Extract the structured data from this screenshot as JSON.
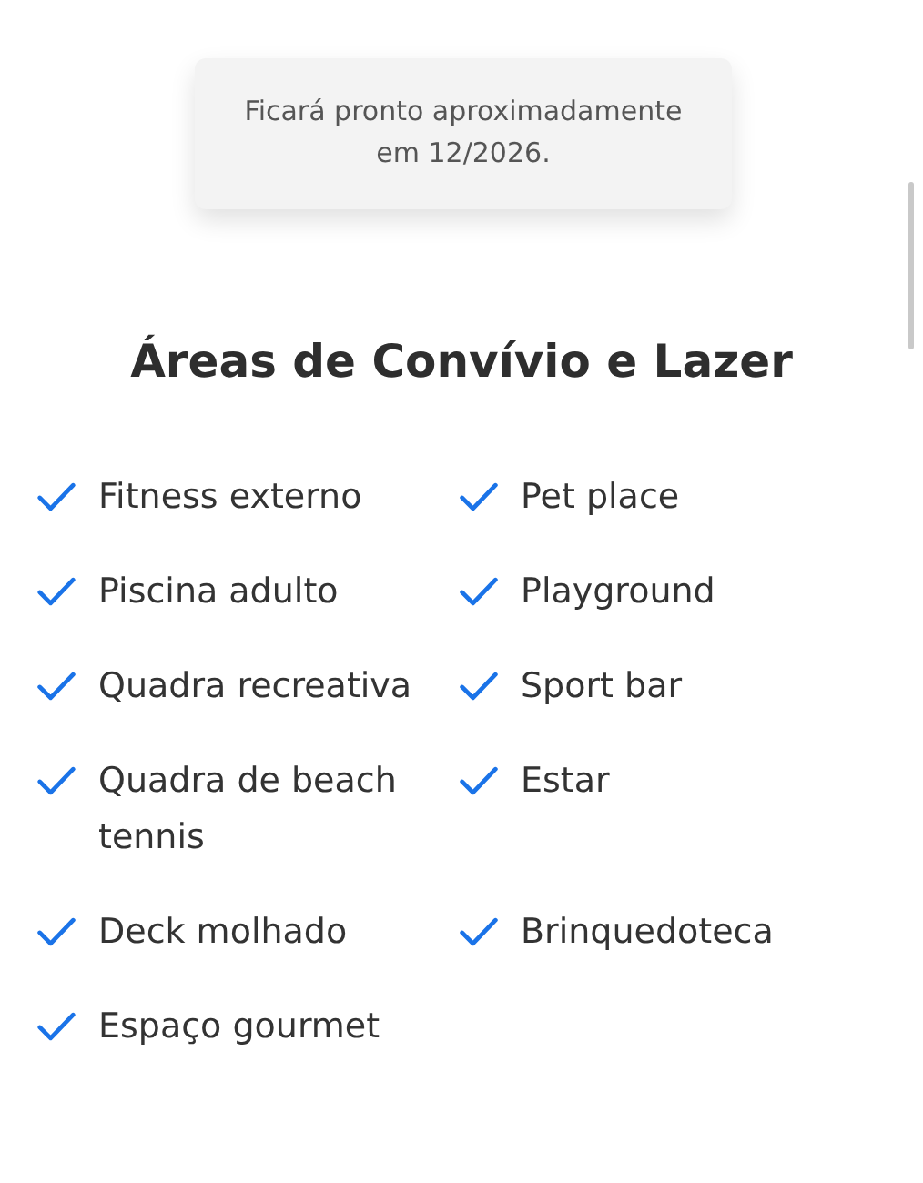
{
  "notice": {
    "text": "Ficará pronto aproximadamente em 12/2026."
  },
  "section": {
    "title": "Áreas de Convívio e Lazer",
    "items": [
      {
        "label": "Fitness externo",
        "checked": true
      },
      {
        "label": "Pet place",
        "checked": true
      },
      {
        "label": "Piscina adulto",
        "checked": true
      },
      {
        "label": "Playground",
        "checked": true
      },
      {
        "label": "Quadra recreativa",
        "checked": true
      },
      {
        "label": "Sport bar",
        "checked": true
      },
      {
        "label": "Quadra de beach tennis",
        "checked": true
      },
      {
        "label": "Estar",
        "checked": true
      },
      {
        "label": "Deck molhado",
        "checked": true
      },
      {
        "label": "Brinquedoteca",
        "checked": true
      },
      {
        "label": "Espaço gourmet",
        "checked": true
      }
    ]
  }
}
